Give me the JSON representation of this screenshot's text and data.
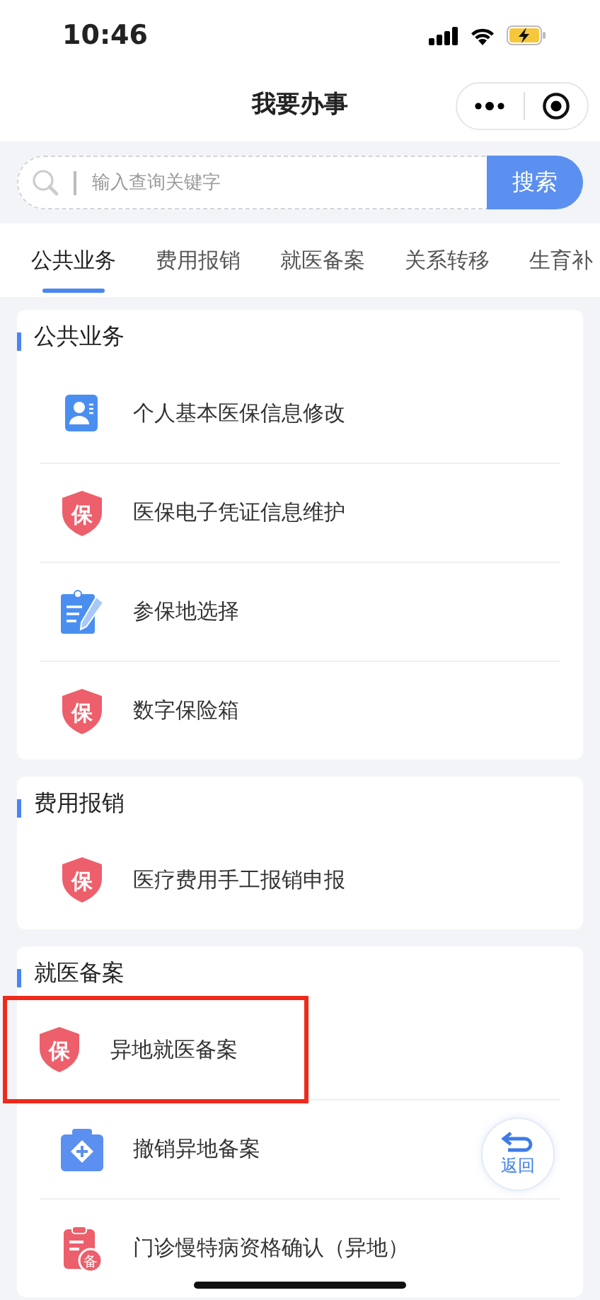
{
  "status_bar": {
    "time": "10:46",
    "charging": true
  },
  "nav": {
    "title": "我要办事"
  },
  "search": {
    "placeholder": "输入查询关键字",
    "button": "搜索"
  },
  "tabs": [
    {
      "label": "公共业务",
      "selected": true
    },
    {
      "label": "费用报销",
      "selected": false
    },
    {
      "label": "就医备案",
      "selected": false
    },
    {
      "label": "关系转移",
      "selected": false
    },
    {
      "label": "生育补",
      "selected": false
    }
  ],
  "sections": [
    {
      "title": "公共业务",
      "items": [
        {
          "label": "个人基本医保信息修改",
          "kind": "profile",
          "highlighted": false
        },
        {
          "label": "医保电子凭证信息维护",
          "kind": "shield",
          "icon_label": "保",
          "highlighted": false
        },
        {
          "label": "参保地选择",
          "kind": "clipboard",
          "highlighted": false
        },
        {
          "label": "数字保险箱",
          "kind": "shield",
          "icon_label": "保",
          "highlighted": false
        }
      ]
    },
    {
      "title": "费用报销",
      "items": [
        {
          "label": "医疗费用手工报销申报",
          "kind": "shield",
          "icon_label": "保",
          "highlighted": false
        }
      ]
    },
    {
      "title": "就医备案",
      "items": [
        {
          "label": "异地就医备案",
          "kind": "shield",
          "icon_label": "保",
          "highlighted": true
        },
        {
          "label": "撤销异地备案",
          "kind": "medkit",
          "highlighted": false
        },
        {
          "label": "门诊慢特病资格确认（异地）",
          "kind": "record",
          "icon_label": "备",
          "highlighted": false
        }
      ]
    }
  ],
  "back_button": {
    "label": "返回"
  }
}
